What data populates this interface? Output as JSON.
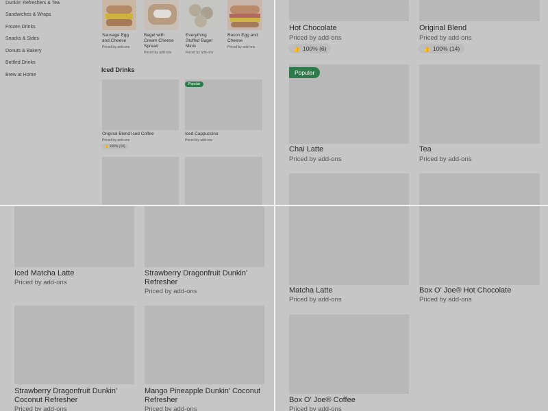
{
  "sidebar": {
    "items": [
      {
        "label": "Dunkin' Refreshers & Tea"
      },
      {
        "label": "Sandwiches & Wraps"
      },
      {
        "label": "Frozen Drinks"
      },
      {
        "label": "Snacks & Sides"
      },
      {
        "label": "Donuts & Bakery"
      },
      {
        "label": "Bottled Drinks"
      },
      {
        "label": "Brew at Home"
      }
    ]
  },
  "sandwiches": [
    {
      "name_line1": "Sausage Egg",
      "name_line2": "and Cheese",
      "name_line3": "",
      "price": "Priced by add-ons"
    },
    {
      "name_line1": "Bagel with",
      "name_line2": "Cream Cheese",
      "name_line3": "Spread",
      "price": "Priced by add-ons"
    },
    {
      "name_line1": "Everything",
      "name_line2": "Stuffed Bagel",
      "name_line3": "Minis",
      "price": "Priced by add-ons"
    },
    {
      "name_line1": "Bacon Egg and",
      "name_line2": "Cheese",
      "name_line3": "",
      "price": "Priced by add-ons"
    }
  ],
  "iced_section": {
    "title": "Iced Drinks",
    "items": [
      {
        "name": "Original Blend Iced Coffee",
        "price": "Priced by add-ons",
        "rating": "100% (10)"
      },
      {
        "name": "Iced Cappuccino",
        "price": "Priced by add-ons",
        "badge": "Popular"
      }
    ]
  },
  "hot_drinks": [
    {
      "name": "Hot Chocolate",
      "price": "Priced by add-ons",
      "rating": "100% (6)"
    },
    {
      "name": "Original Blend",
      "price": "Priced by add-ons",
      "rating": "100% (14)"
    },
    {
      "name": "Chai Latte",
      "price": "Priced by add-ons",
      "badge": "Popular"
    },
    {
      "name": "Tea",
      "price": "Priced by add-ons"
    }
  ],
  "iced_more": [
    {
      "name": "Iced Matcha Latte",
      "price": "Priced by add-ons"
    },
    {
      "name_line1": "Strawberry Dragonfruit Dunkin'",
      "name_line2": "Refresher",
      "price": "Priced by add-ons"
    },
    {
      "name_line1": "Strawberry Dragonfruit Dunkin'",
      "name_line2": "Coconut Refresher",
      "price": "Priced by add-ons"
    },
    {
      "name_line1": "Mango Pineapple Dunkin' Coconut",
      "name_line2": "Refresher",
      "price": "Priced by add-ons"
    }
  ],
  "hot_more": [
    {
      "name": "Matcha Latte",
      "price": "Priced by add-ons"
    },
    {
      "name": "Box O' Joe® Hot Chocolate",
      "price": "Priced by add-ons"
    },
    {
      "name": "Box O' Joe® Coffee",
      "price": "Priced by add-ons"
    }
  ],
  "icons": {
    "rating": "thumbs-up-icon"
  },
  "colors": {
    "badge": "#2f7a4a",
    "overlay": "#c6c6c6",
    "divider": "#f2f2f2"
  }
}
